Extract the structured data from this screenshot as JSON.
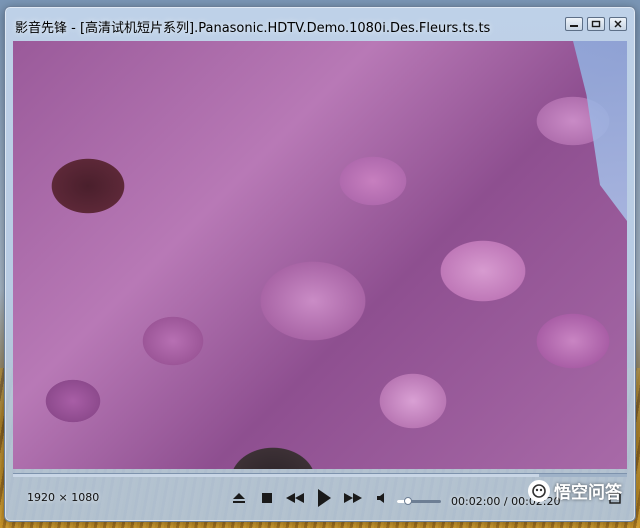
{
  "window": {
    "title": "影音先锋 - [高清试机短片系列].Panasonic.HDTV.Demo.1080i.Des.Fleurs.ts.ts"
  },
  "title_controls": {
    "minimize_icon": "minimize-icon",
    "restore_icon": "restore-icon",
    "close_icon": "close-icon"
  },
  "player": {
    "resolution": "1920 × 1080",
    "time_current": "00:02:00",
    "time_separator": " / ",
    "time_total": "00:02:20",
    "playback_progress": 0.857,
    "volume_level": 0.25,
    "buttons": {
      "eject": "eject-icon",
      "stop": "stop-icon",
      "rewind": "rewind-icon",
      "play": "play-icon",
      "fast_forward": "fast-forward-icon",
      "volume": "speaker-icon",
      "fullscreen": "fullscreen-icon"
    }
  },
  "watermark": {
    "text": "悟空问答"
  },
  "colors": {
    "title_bar": "#c4d6ec",
    "icon": "#1a1a1a",
    "accent": "#ffffff"
  }
}
